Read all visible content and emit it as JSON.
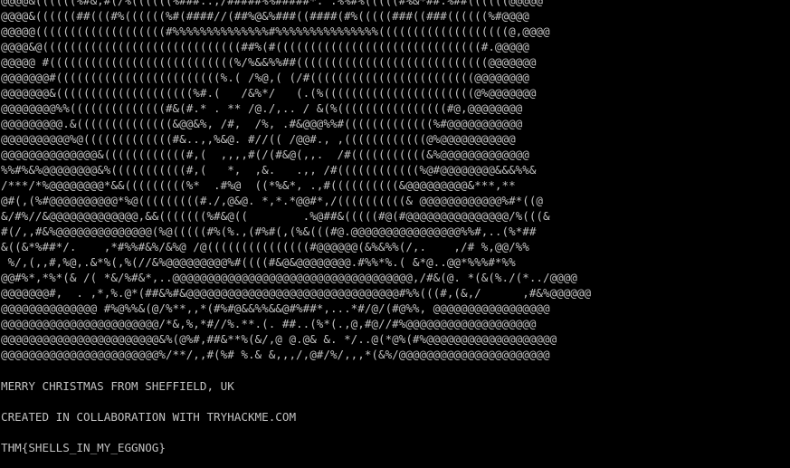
{
  "terminal": {
    "ascii_art": [
      "@@@@&((((((%#&,#(/%((((((%###..,/#####%%#####*. .%%#%(((((#%&*##.%##((((((@@@@@",
      "@@@@&((((((##(((#%((((((%#(####//(##%@&%###((####(#%(((((###((###((((((%#@@@@",
      "@@@@@(((((((((((((((((((#%%%%%%%%%%%%%%#%%%%%%%%%%%%%%%(((((((((((((((((((@,@@@@",
      "@@@@&@(((((((((((((((((((((((((((((##%(#((((((((((((((((((((((((((((((#.@@@@@",
      "@@@@@ #(((((((((((((((((((((((((((%/%&&%%##((((((((((((((((((((((((((((@@@@@@@",
      "@@@@@@@#((((((((((((((((((((((((%.( /%@,( (/#((((((((((((((((((((((((@@@@@@@@",
      "@@@@@@@&((((((((((((((((((((%#.(   /&%*/   (.(%((((((((((((((((((((((@%@@@@@@@",
      "@@@@@@@@%%((((((((((((((#&(#.* . ** /@./,.. / &(%((((((((((((((((#@,@@@@@@@@",
      "@@@@@@@@@.&((((((((((((((&@@&%, /#,  /%, .#&@@@%%#(((((((((((((%#@@@@@@@@@@@",
      "@@@@@@@@@@%@(((((((((((((#&..,,%&@. #//(( /@@#., ,((((((((((((@%@@@@@@@@@@@",
      "@@@@@@@@@@@@@@&((((((((((((#,(  ,,,,#(/(#&@(,,.  /#(((((((((((&%@@@@@@@@@@@@@",
      "%%#%&%@@@@@@@@&%(((((((((((#,(   *,  ,&.   .,, /#((((((((((((%@#@@@@@@@@&&&%%&",
      "/***/*%@@@@@@@@*&&(((((((((%*  .#%@  ((*%&*, .,#((((((((((&@@@@@@@@@&***,**",
      "@#(,(%#@@@@@@@@@@*%@(((((((((#./,@&@. *,*.*@@#*,/((((((((((& @@@@@@@@@@@@%#*((@",
      "&/#%//&@@@@@@@@@@@@@,&&(((((((%#&@((        .%@##&(((((#@(#@@@@@@@@@@@@@@@/%(((&",
      "#(/,,#&%@@@@@@@@@@@@@@(%@(((((#%(%.,(#%#(,(%&(((#@.@@@@@@@@@@@@@@@@%%#,..(%*##",
      "&((&*%##*/.    ,*#%%#&%/&%@ /@(((((((((((((((#@@@@@@(&%&%%(/,.    ,/# %,@@/%%",
      " %/,(,,#,%@,.&*%(,%(//&%@@@@@@@@@%#((((#&@&@@@@@@@@.#%%*%.( &*@..@@*%%%#*%%",
      "@@#%*,*%*(& /( *&/%#&*,..@@@@@@@@@@@@@@@@@@@@@@@@@@@@@@@@@@@,/#&(@. *(&(%./(*../@@@@",
      "@@@@@@@#,  . ,*,%.@*(##&%#&@@@@@@@@@@@@@@@@@@@@@@@@@@@@@@@#%%(((#,(&,/      ,#&%@@@@@@",
      "@@@@@@@@@@@@@@ #%@%%&(@/%**,,*(#%#@&&%%&&@#%##*,...*#/@/(#@%%, @@@@@@@@@@@@@@@@@",
      "@@@@@@@@@@@@@@@@@@@@@@@/*&,%,*#//%.**.(. ##..(%*(.,@,#@//#%@@@@@@@@@@@@@@@@@@@",
      "@@@@@@@@@@@@@@@@@@@@@@@&%(@%#,##&**%(&/,@ @.@& &. */..@(*@%(#%@@@@@@@@@@@@@@@@@@@",
      "@@@@@@@@@@@@@@@@@@@@@@@%/**/,,#(%# %.& &,,,/,@#/%/,,,*(&%/@@@@@@@@@@@@@@@@@@@@@@"
    ],
    "messages": {
      "greeting": "MERRY CHRISTMAS FROM SHEFFIELD, UK",
      "credit": "CREATED IN COLLABORATION WITH TRYHACKME.COM",
      "flag": "THM{SHELLS_IN_MY_EGGNOG}"
    },
    "colors": {
      "background": "#000000",
      "foreground": "#c0c0c0"
    }
  }
}
